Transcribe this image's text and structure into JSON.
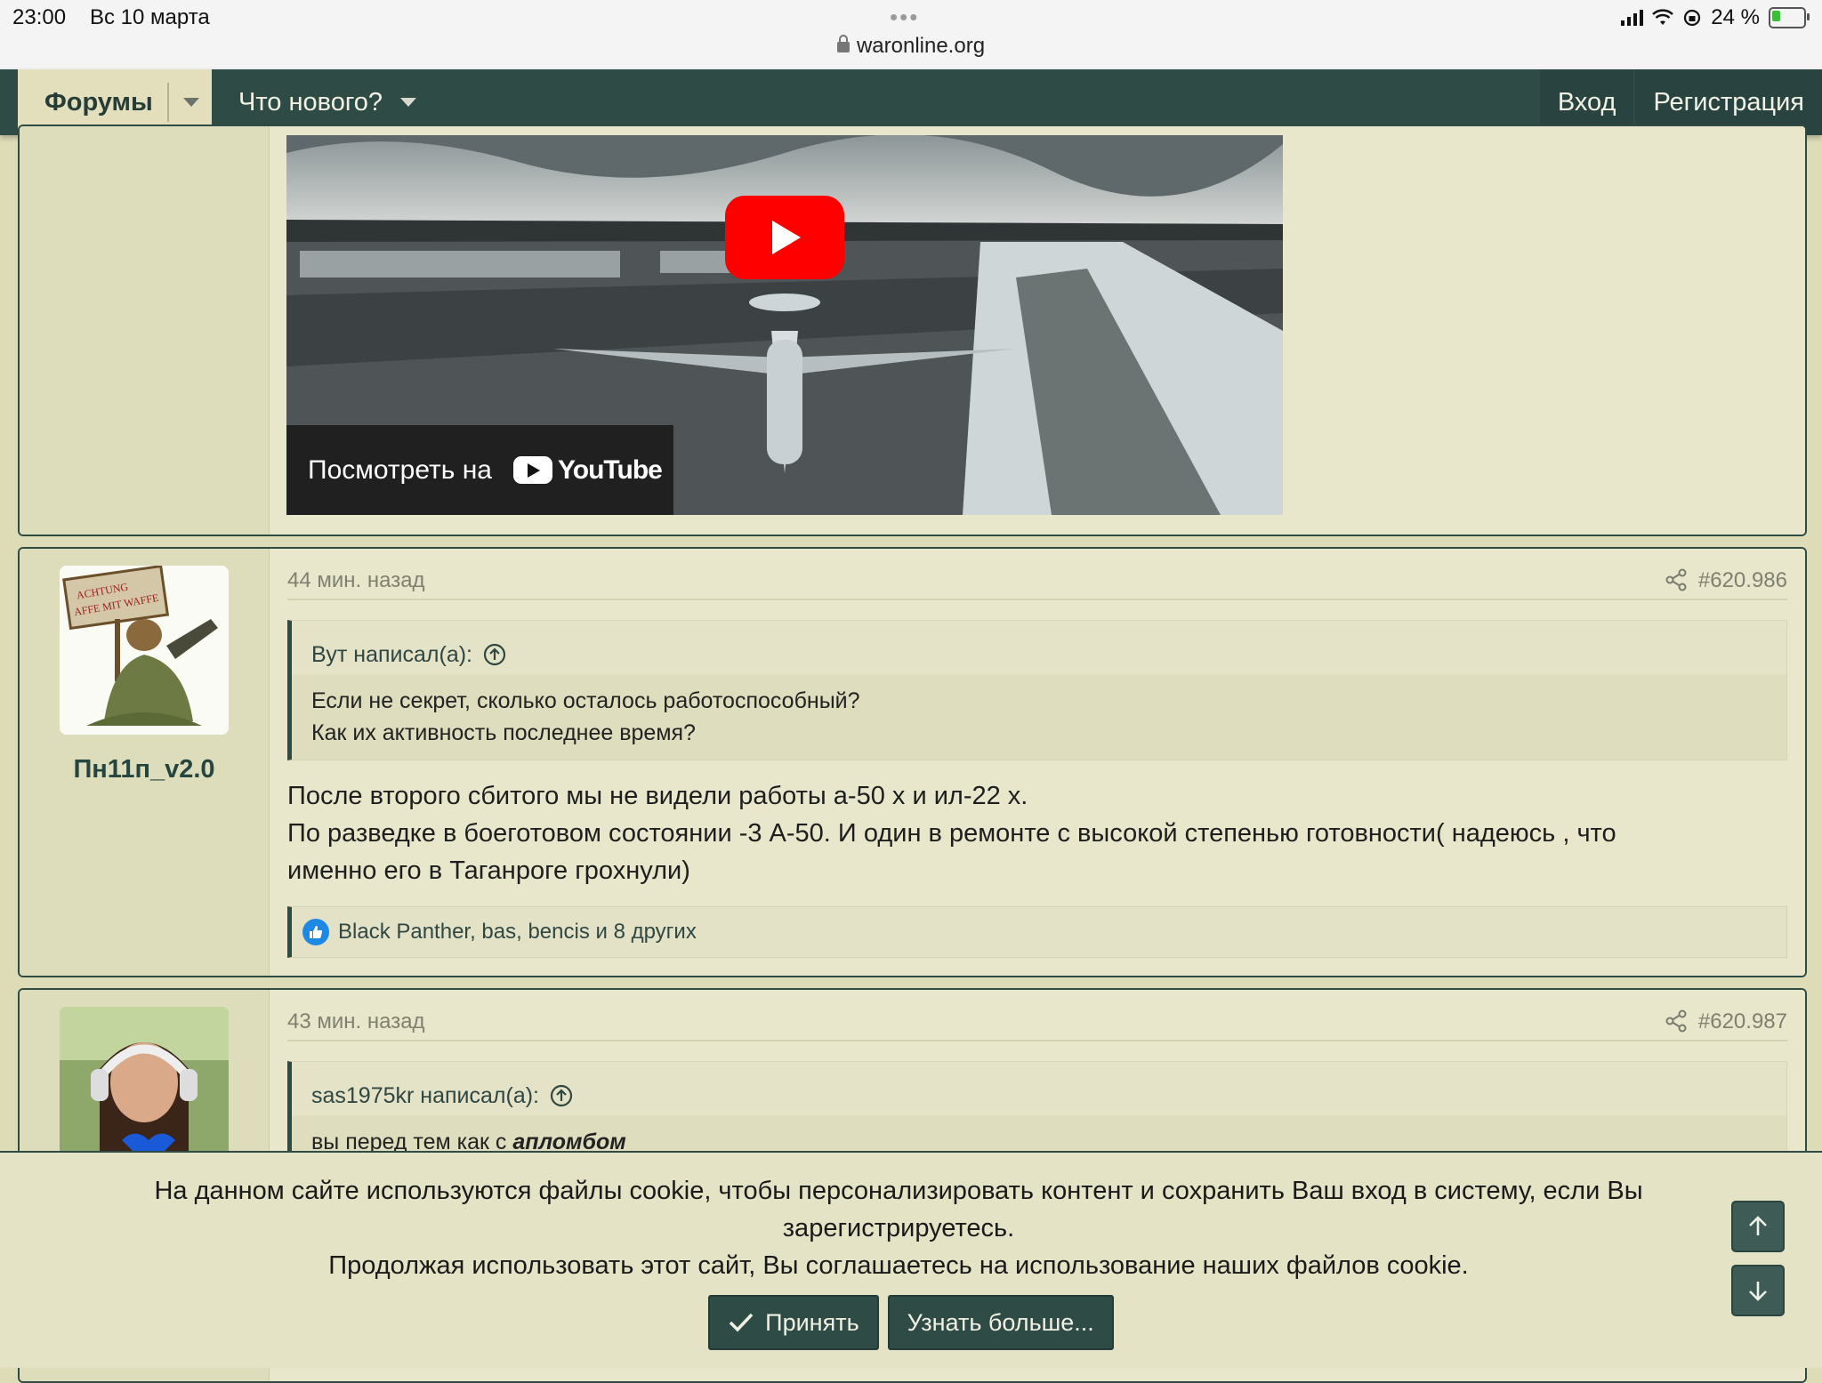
{
  "status_bar": {
    "time": "23:00",
    "date": "Вс 10 марта",
    "battery": "24 %",
    "url": "waronline.org"
  },
  "nav": {
    "forums": "Форумы",
    "whats_new": "Что нового?",
    "login": "Вход",
    "register": "Регистрация"
  },
  "video": {
    "watch_on": "Посмотреть на",
    "youtube": "YouTube"
  },
  "posts": [
    {
      "author": "Пн11п_v2.0",
      "avatar_text": "ACHTUNG AFFE MIT WAFFE",
      "time": "44 мин. назад",
      "number": "#620.986",
      "quote_author": "Вут написал(а):",
      "quote_lines": [
        "Если не секрет, сколько осталось работоспособный?",
        "Как их активность последнее время?"
      ],
      "text_lines": [
        "После второго сбитого мы не видели работы а-50 х и ил-22 х.",
        "По разведке в боеготовом состоянии -3 А-50. И один в ремонте с высокой степенью готовности( надеюсь , что",
        "именно его в Таганроге грохнули)"
      ],
      "reactions": "Black Panther, bas, bencis и 8 других"
    },
    {
      "time": "43 мин. назад",
      "number": "#620.987",
      "quote_author": "sas1975kr написал(а):",
      "quote_line_start": "вы перед тем как с ",
      "quote_line_emph": "апломбом"
    }
  ],
  "cookie": {
    "line1": "На данном сайте используются файлы cookie, чтобы персонализировать контент и сохранить Ваш вход в систему, если Вы",
    "line2": "зарегистрируетесь.",
    "line3": "Продолжая использовать этот сайт, Вы соглашаетесь на использование наших файлов cookie.",
    "accept": "Принять",
    "learn_more": "Узнать больше..."
  }
}
